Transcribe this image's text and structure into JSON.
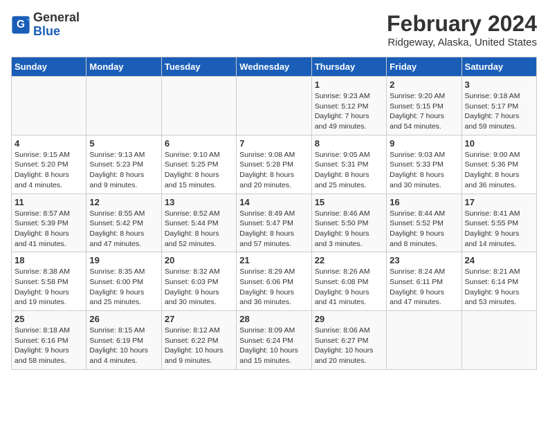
{
  "header": {
    "logo_line1": "General",
    "logo_line2": "Blue",
    "month": "February 2024",
    "location": "Ridgeway, Alaska, United States"
  },
  "weekdays": [
    "Sunday",
    "Monday",
    "Tuesday",
    "Wednesday",
    "Thursday",
    "Friday",
    "Saturday"
  ],
  "weeks": [
    [
      {
        "day": "",
        "info": ""
      },
      {
        "day": "",
        "info": ""
      },
      {
        "day": "",
        "info": ""
      },
      {
        "day": "",
        "info": ""
      },
      {
        "day": "1",
        "info": "Sunrise: 9:23 AM\nSunset: 5:12 PM\nDaylight: 7 hours\nand 49 minutes."
      },
      {
        "day": "2",
        "info": "Sunrise: 9:20 AM\nSunset: 5:15 PM\nDaylight: 7 hours\nand 54 minutes."
      },
      {
        "day": "3",
        "info": "Sunrise: 9:18 AM\nSunset: 5:17 PM\nDaylight: 7 hours\nand 59 minutes."
      }
    ],
    [
      {
        "day": "4",
        "info": "Sunrise: 9:15 AM\nSunset: 5:20 PM\nDaylight: 8 hours\nand 4 minutes."
      },
      {
        "day": "5",
        "info": "Sunrise: 9:13 AM\nSunset: 5:23 PM\nDaylight: 8 hours\nand 9 minutes."
      },
      {
        "day": "6",
        "info": "Sunrise: 9:10 AM\nSunset: 5:25 PM\nDaylight: 8 hours\nand 15 minutes."
      },
      {
        "day": "7",
        "info": "Sunrise: 9:08 AM\nSunset: 5:28 PM\nDaylight: 8 hours\nand 20 minutes."
      },
      {
        "day": "8",
        "info": "Sunrise: 9:05 AM\nSunset: 5:31 PM\nDaylight: 8 hours\nand 25 minutes."
      },
      {
        "day": "9",
        "info": "Sunrise: 9:03 AM\nSunset: 5:33 PM\nDaylight: 8 hours\nand 30 minutes."
      },
      {
        "day": "10",
        "info": "Sunrise: 9:00 AM\nSunset: 5:36 PM\nDaylight: 8 hours\nand 36 minutes."
      }
    ],
    [
      {
        "day": "11",
        "info": "Sunrise: 8:57 AM\nSunset: 5:39 PM\nDaylight: 8 hours\nand 41 minutes."
      },
      {
        "day": "12",
        "info": "Sunrise: 8:55 AM\nSunset: 5:42 PM\nDaylight: 8 hours\nand 47 minutes."
      },
      {
        "day": "13",
        "info": "Sunrise: 8:52 AM\nSunset: 5:44 PM\nDaylight: 8 hours\nand 52 minutes."
      },
      {
        "day": "14",
        "info": "Sunrise: 8:49 AM\nSunset: 5:47 PM\nDaylight: 8 hours\nand 57 minutes."
      },
      {
        "day": "15",
        "info": "Sunrise: 8:46 AM\nSunset: 5:50 PM\nDaylight: 9 hours\nand 3 minutes."
      },
      {
        "day": "16",
        "info": "Sunrise: 8:44 AM\nSunset: 5:52 PM\nDaylight: 9 hours\nand 8 minutes."
      },
      {
        "day": "17",
        "info": "Sunrise: 8:41 AM\nSunset: 5:55 PM\nDaylight: 9 hours\nand 14 minutes."
      }
    ],
    [
      {
        "day": "18",
        "info": "Sunrise: 8:38 AM\nSunset: 5:58 PM\nDaylight: 9 hours\nand 19 minutes."
      },
      {
        "day": "19",
        "info": "Sunrise: 8:35 AM\nSunset: 6:00 PM\nDaylight: 9 hours\nand 25 minutes."
      },
      {
        "day": "20",
        "info": "Sunrise: 8:32 AM\nSunset: 6:03 PM\nDaylight: 9 hours\nand 30 minutes."
      },
      {
        "day": "21",
        "info": "Sunrise: 8:29 AM\nSunset: 6:06 PM\nDaylight: 9 hours\nand 36 minutes."
      },
      {
        "day": "22",
        "info": "Sunrise: 8:26 AM\nSunset: 6:08 PM\nDaylight: 9 hours\nand 41 minutes."
      },
      {
        "day": "23",
        "info": "Sunrise: 8:24 AM\nSunset: 6:11 PM\nDaylight: 9 hours\nand 47 minutes."
      },
      {
        "day": "24",
        "info": "Sunrise: 8:21 AM\nSunset: 6:14 PM\nDaylight: 9 hours\nand 53 minutes."
      }
    ],
    [
      {
        "day": "25",
        "info": "Sunrise: 8:18 AM\nSunset: 6:16 PM\nDaylight: 9 hours\nand 58 minutes."
      },
      {
        "day": "26",
        "info": "Sunrise: 8:15 AM\nSunset: 6:19 PM\nDaylight: 10 hours\nand 4 minutes."
      },
      {
        "day": "27",
        "info": "Sunrise: 8:12 AM\nSunset: 6:22 PM\nDaylight: 10 hours\nand 9 minutes."
      },
      {
        "day": "28",
        "info": "Sunrise: 8:09 AM\nSunset: 6:24 PM\nDaylight: 10 hours\nand 15 minutes."
      },
      {
        "day": "29",
        "info": "Sunrise: 8:06 AM\nSunset: 6:27 PM\nDaylight: 10 hours\nand 20 minutes."
      },
      {
        "day": "",
        "info": ""
      },
      {
        "day": "",
        "info": ""
      }
    ]
  ]
}
